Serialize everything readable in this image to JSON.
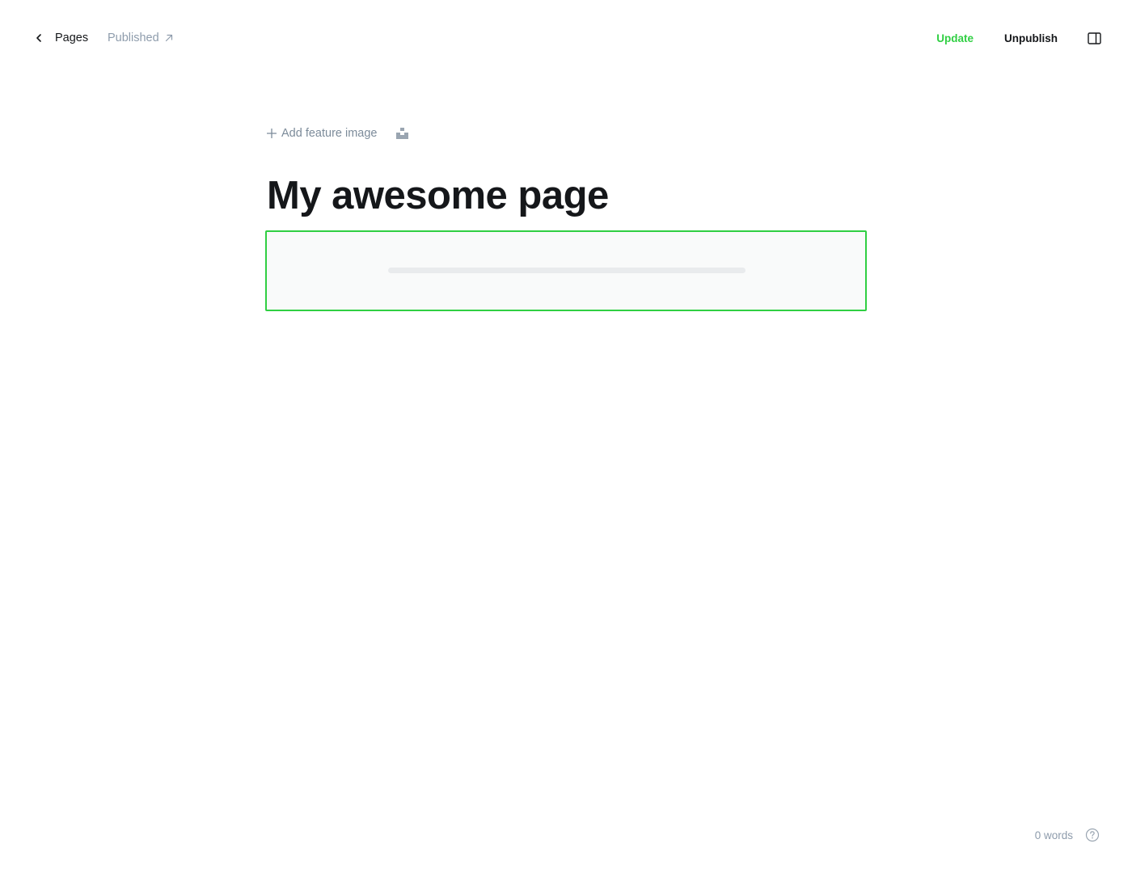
{
  "header": {
    "back_label": "Pages",
    "status_label": "Published",
    "update_label": "Update",
    "unpublish_label": "Unpublish"
  },
  "editor": {
    "add_feature_label": "Add feature image",
    "title": "My awesome page"
  },
  "footer": {
    "word_count": "0 words"
  },
  "icons": {
    "back": "chevron-left-icon",
    "status_link": "external-arrow-icon",
    "sidebar_toggle": "sidebar-toggle-icon",
    "add": "plus-icon",
    "unsplash": "unsplash-icon",
    "help": "question-circle-icon"
  },
  "colors": {
    "accent": "#30cf43",
    "muted": "#8e9cac",
    "text": "#15171a"
  }
}
